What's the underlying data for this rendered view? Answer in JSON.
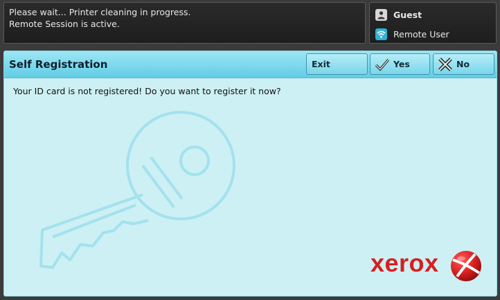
{
  "status": {
    "line1": "Please wait... Printer cleaning in progress.",
    "line2": "Remote Session is active."
  },
  "user_panel": {
    "guest_label": "Guest",
    "remote_label": "Remote User",
    "guest_icon": "person-icon",
    "remote_icon": "wifi-icon"
  },
  "dialog": {
    "title": "Self Registration",
    "buttons": {
      "exit": "Exit",
      "yes": "Yes",
      "no": "No"
    },
    "message": "Your ID card is not registered! Do you want to register it now?",
    "background_icon": "key-icon"
  },
  "brand": {
    "logo_text": "xerox",
    "color": "#d71f1f"
  }
}
